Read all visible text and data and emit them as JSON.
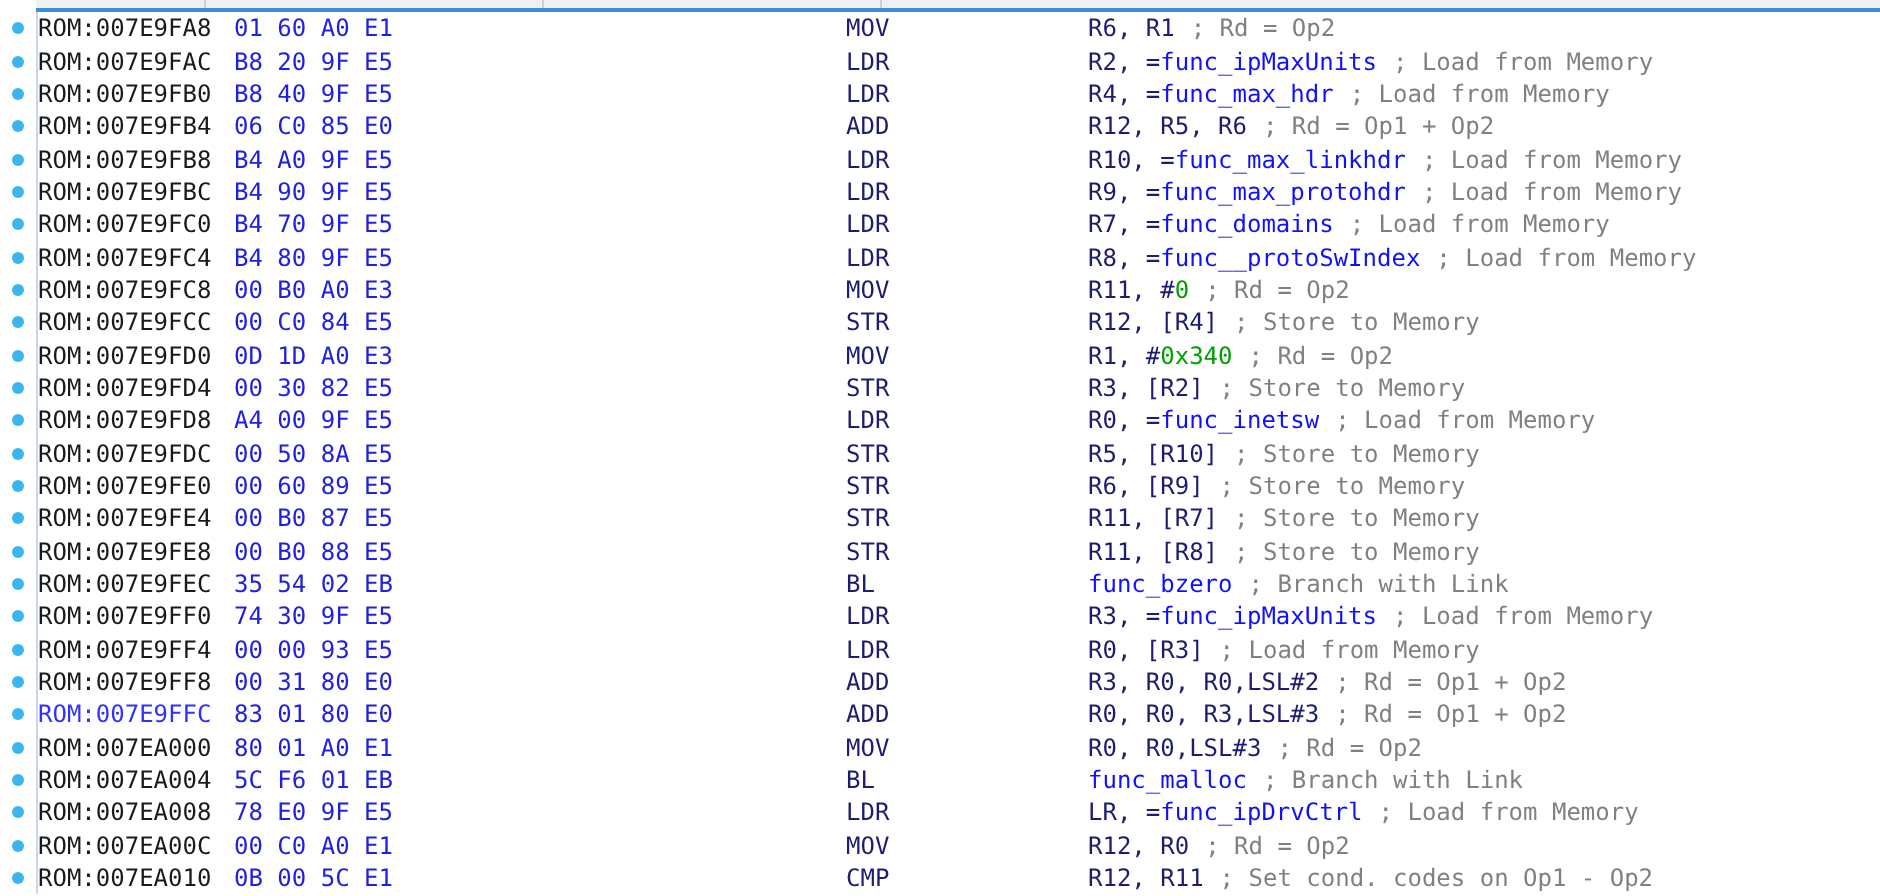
{
  "rows": [
    {
      "address": "ROM:007E9FA8",
      "bytes": "01 60 A0 E1",
      "mnemonic": "MOV",
      "operands": [
        {
          "t": "R6, R1",
          "kind": "reg"
        }
      ],
      "comment": "; Rd = Op2",
      "highlighted": false
    },
    {
      "address": "ROM:007E9FAC",
      "bytes": "B8 20 9F E5",
      "mnemonic": "LDR",
      "operands": [
        {
          "t": "R2, =",
          "kind": "reg"
        },
        {
          "t": "func_ipMaxUnits",
          "kind": "name"
        }
      ],
      "comment": "; Load from Memory",
      "highlighted": false
    },
    {
      "address": "ROM:007E9FB0",
      "bytes": "B8 40 9F E5",
      "mnemonic": "LDR",
      "operands": [
        {
          "t": "R4, =",
          "kind": "reg"
        },
        {
          "t": "func_max_hdr",
          "kind": "name"
        }
      ],
      "comment": "; Load from Memory",
      "highlighted": false
    },
    {
      "address": "ROM:007E9FB4",
      "bytes": "06 C0 85 E0",
      "mnemonic": "ADD",
      "operands": [
        {
          "t": "R12, R5, R6",
          "kind": "reg"
        }
      ],
      "comment": "; Rd = Op1 + Op2",
      "highlighted": false
    },
    {
      "address": "ROM:007E9FB8",
      "bytes": "B4 A0 9F E5",
      "mnemonic": "LDR",
      "operands": [
        {
          "t": "R10, =",
          "kind": "reg"
        },
        {
          "t": "func_max_linkhdr",
          "kind": "name"
        }
      ],
      "comment": "; Load from Memory",
      "highlighted": false
    },
    {
      "address": "ROM:007E9FBC",
      "bytes": "B4 90 9F E5",
      "mnemonic": "LDR",
      "operands": [
        {
          "t": "R9, =",
          "kind": "reg"
        },
        {
          "t": "func_max_protohdr",
          "kind": "name"
        }
      ],
      "comment": "; Load from Memory",
      "highlighted": false
    },
    {
      "address": "ROM:007E9FC0",
      "bytes": "B4 70 9F E5",
      "mnemonic": "LDR",
      "operands": [
        {
          "t": "R7, =",
          "kind": "reg"
        },
        {
          "t": "func_domains",
          "kind": "name"
        }
      ],
      "comment": "; Load from Memory",
      "highlighted": false
    },
    {
      "address": "ROM:007E9FC4",
      "bytes": "B4 80 9F E5",
      "mnemonic": "LDR",
      "operands": [
        {
          "t": "R8, =",
          "kind": "reg"
        },
        {
          "t": "func__protoSwIndex",
          "kind": "name"
        }
      ],
      "comment": "; Load from Memory",
      "highlighted": false
    },
    {
      "address": "ROM:007E9FC8",
      "bytes": "00 B0 A0 E3",
      "mnemonic": "MOV",
      "operands": [
        {
          "t": "R11, #",
          "kind": "reg"
        },
        {
          "t": "0",
          "kind": "imm"
        }
      ],
      "comment": "; Rd = Op2",
      "highlighted": false
    },
    {
      "address": "ROM:007E9FCC",
      "bytes": "00 C0 84 E5",
      "mnemonic": "STR",
      "operands": [
        {
          "t": "R12, [R4]",
          "kind": "reg"
        }
      ],
      "comment": "; Store to Memory",
      "highlighted": false
    },
    {
      "address": "ROM:007E9FD0",
      "bytes": "0D 1D A0 E3",
      "mnemonic": "MOV",
      "operands": [
        {
          "t": "R1, #",
          "kind": "reg"
        },
        {
          "t": "0x340",
          "kind": "imm"
        }
      ],
      "comment": "; Rd = Op2",
      "highlighted": false
    },
    {
      "address": "ROM:007E9FD4",
      "bytes": "00 30 82 E5",
      "mnemonic": "STR",
      "operands": [
        {
          "t": "R3, [R2]",
          "kind": "reg"
        }
      ],
      "comment": "; Store to Memory",
      "highlighted": false
    },
    {
      "address": "ROM:007E9FD8",
      "bytes": "A4 00 9F E5",
      "mnemonic": "LDR",
      "operands": [
        {
          "t": "R0, =",
          "kind": "reg"
        },
        {
          "t": "func_inetsw",
          "kind": "name"
        }
      ],
      "comment": "; Load from Memory",
      "highlighted": false
    },
    {
      "address": "ROM:007E9FDC",
      "bytes": "00 50 8A E5",
      "mnemonic": "STR",
      "operands": [
        {
          "t": "R5, [R10]",
          "kind": "reg"
        }
      ],
      "comment": "; Store to Memory",
      "highlighted": false
    },
    {
      "address": "ROM:007E9FE0",
      "bytes": "00 60 89 E5",
      "mnemonic": "STR",
      "operands": [
        {
          "t": "R6, [R9]",
          "kind": "reg"
        }
      ],
      "comment": "; Store to Memory",
      "highlighted": false
    },
    {
      "address": "ROM:007E9FE4",
      "bytes": "00 B0 87 E5",
      "mnemonic": "STR",
      "operands": [
        {
          "t": "R11, [R7]",
          "kind": "reg"
        }
      ],
      "comment": "; Store to Memory",
      "highlighted": false
    },
    {
      "address": "ROM:007E9FE8",
      "bytes": "00 B0 88 E5",
      "mnemonic": "STR",
      "operands": [
        {
          "t": "R11, [R8]",
          "kind": "reg"
        }
      ],
      "comment": "; Store to Memory",
      "highlighted": false
    },
    {
      "address": "ROM:007E9FEC",
      "bytes": "35 54 02 EB",
      "mnemonic": "BL",
      "operands": [
        {
          "t": "func_bzero",
          "kind": "name"
        }
      ],
      "comment": "; Branch with Link",
      "highlighted": false
    },
    {
      "address": "ROM:007E9FF0",
      "bytes": "74 30 9F E5",
      "mnemonic": "LDR",
      "operands": [
        {
          "t": "R3, =",
          "kind": "reg"
        },
        {
          "t": "func_ipMaxUnits",
          "kind": "name"
        }
      ],
      "comment": "; Load from Memory",
      "highlighted": false
    },
    {
      "address": "ROM:007E9FF4",
      "bytes": "00 00 93 E5",
      "mnemonic": "LDR",
      "operands": [
        {
          "t": "R0, [R3]",
          "kind": "reg"
        }
      ],
      "comment": "; Load from Memory",
      "highlighted": false
    },
    {
      "address": "ROM:007E9FF8",
      "bytes": "00 31 80 E0",
      "mnemonic": "ADD",
      "operands": [
        {
          "t": "R3, R0, R0,LSL#2",
          "kind": "reg"
        }
      ],
      "comment": "; Rd = Op1 + Op2",
      "highlighted": false
    },
    {
      "address": "ROM:007E9FFC",
      "bytes": "83 01 80 E0",
      "mnemonic": "ADD",
      "operands": [
        {
          "t": "R0, R0, R3,LSL#3",
          "kind": "reg"
        }
      ],
      "comment": "; Rd = Op1 + Op2",
      "highlighted": true
    },
    {
      "address": "ROM:007EA000",
      "bytes": "80 01 A0 E1",
      "mnemonic": "MOV",
      "operands": [
        {
          "t": "R0, R0,LSL#3",
          "kind": "reg"
        }
      ],
      "comment": "; Rd = Op2",
      "highlighted": false
    },
    {
      "address": "ROM:007EA004",
      "bytes": "5C F6 01 EB",
      "mnemonic": "BL",
      "operands": [
        {
          "t": "func_malloc",
          "kind": "name"
        }
      ],
      "comment": "; Branch with Link",
      "highlighted": false
    },
    {
      "address": "ROM:007EA008",
      "bytes": "78 E0 9F E5",
      "mnemonic": "LDR",
      "operands": [
        {
          "t": "LR, =",
          "kind": "reg"
        },
        {
          "t": "func_ipDrvCtrl",
          "kind": "name"
        }
      ],
      "comment": "; Load from Memory",
      "highlighted": false
    },
    {
      "address": "ROM:007EA00C",
      "bytes": "00 C0 A0 E1",
      "mnemonic": "MOV",
      "operands": [
        {
          "t": "R12, R0",
          "kind": "reg"
        }
      ],
      "comment": "; Rd = Op2",
      "highlighted": false
    },
    {
      "address": "ROM:007EA010",
      "bytes": "0B 00 5C E1",
      "mnemonic": "CMP",
      "operands": [
        {
          "t": "R12, R11",
          "kind": "reg"
        }
      ],
      "comment": "; Set cond. codes on Op1 - Op2",
      "highlighted": false
    }
  ]
}
